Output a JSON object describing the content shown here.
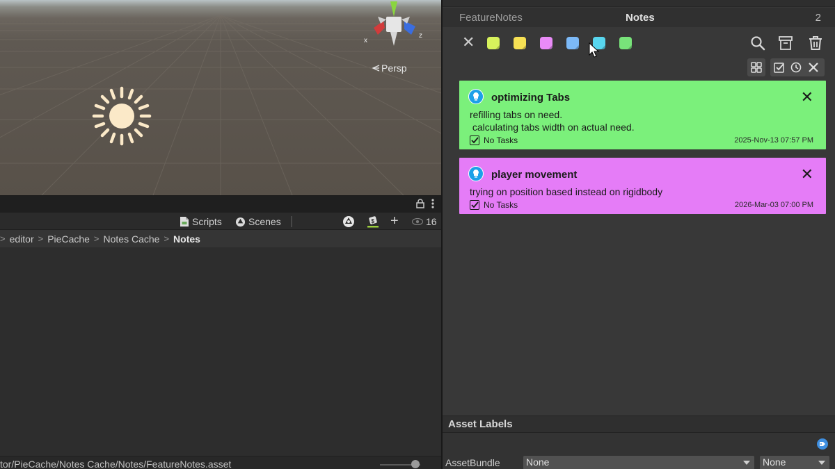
{
  "scene": {
    "axis_x": "x",
    "axis_z": "z",
    "projection_label": "Persp",
    "colors": {
      "ground": "#5d574f",
      "sky": "#b9c3c5"
    }
  },
  "project": {
    "toolbar": {
      "scripts_label": "Scripts",
      "scenes_label": "Scenes",
      "visible_count": "16"
    },
    "breadcrumbs": [
      "editor",
      "PieCache",
      "Notes Cache",
      "Notes"
    ],
    "status_path": "tor/PieCache/Notes Cache/Notes/FeatureNotes.asset"
  },
  "notes_panel": {
    "asset_name": "FeatureNotes",
    "title": "Notes",
    "count": "2",
    "swatches": [
      {
        "name": "lime",
        "color": "#d7f25c"
      },
      {
        "name": "yellow",
        "color": "#f7e154"
      },
      {
        "name": "pink",
        "color": "#e98bf7"
      },
      {
        "name": "blue",
        "color": "#7cb9f7"
      },
      {
        "name": "cyan",
        "color": "#58d6ef"
      },
      {
        "name": "green",
        "color": "#78e37a"
      }
    ],
    "notes": [
      {
        "title": "optimizing Tabs",
        "body": "refilling tabs on need.\n calculating tabs width on actual need.",
        "tasks": "No Tasks",
        "date": "2025-Nov-13 07:57 PM",
        "color": "#7bf07b"
      },
      {
        "title": "player movement",
        "body": "trying on position based instead on rigidbody",
        "tasks": "No Tasks",
        "date": "2026-Mar-03 07:00 PM",
        "color": "#e57cf7"
      }
    ]
  },
  "asset_labels": {
    "header": "Asset Labels",
    "assetbundle_label": "AssetBundle",
    "bundle_value": "None",
    "variant_value": "None"
  }
}
